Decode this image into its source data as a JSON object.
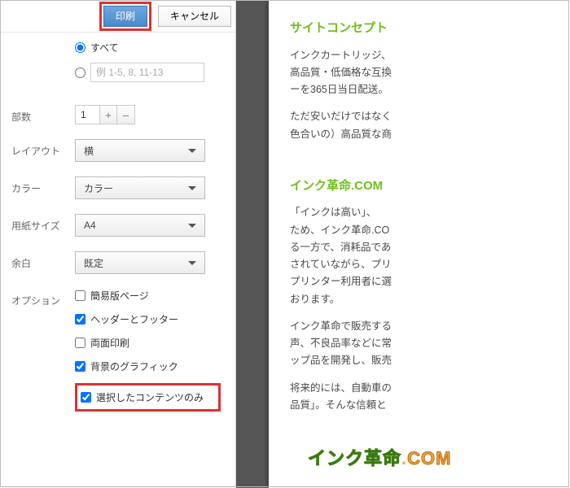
{
  "buttons": {
    "print": "印刷",
    "cancel": "キャンセル"
  },
  "pages": {
    "all_label": "すべて",
    "range_placeholder": "例 1-5, 8, 11-13"
  },
  "copies": {
    "label": "部数",
    "value": "1"
  },
  "layout": {
    "label": "レイアウト",
    "value": "横"
  },
  "color": {
    "label": "カラー",
    "value": "カラー"
  },
  "paper": {
    "label": "用紙サイズ",
    "value": "A4"
  },
  "margin": {
    "label": "余白",
    "value": "既定"
  },
  "options": {
    "label": "オプション",
    "simple_page": "簡易版ページ",
    "header_footer": "ヘッダーとフッター",
    "duplex": "両面印刷",
    "bg_graphics": "背景のグラフィック",
    "selection_only": "選択したコンテンツのみ"
  },
  "preview": {
    "h1": "サイトコンセプト",
    "p1": "インクカートリッジ、",
    "p2": "高品質・低価格な互換",
    "p3": "ーを365日当日配送。",
    "p4": "ただ安いだけではなく",
    "p5": "色合いの）高品質な商",
    "h2": "インク革命.COM",
    "p6": "「インクは高い」、",
    "p7": "ため、インク革命.CO",
    "p8": "る一方で、消耗品であ",
    "p9": "されていながら、プリ",
    "p10": "プリンター利用者に選",
    "p11": "おります。",
    "p12": "インク革命で販売する",
    "p13": "声、不良品率などに常",
    "p14": "ップ品を開発し、販売",
    "p15": "将来的には、自動車の",
    "p16": "品質」。そんな信頼と",
    "logo": "インク革命.COM"
  }
}
